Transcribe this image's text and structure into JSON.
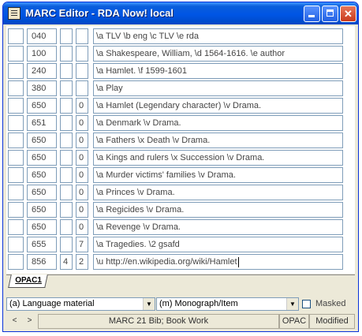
{
  "window": {
    "title": "MARC Editor - RDA Now! local"
  },
  "fields": [
    {
      "tag": "040",
      "ind1": "",
      "ind2": "",
      "data": "\\a TLV \\b eng \\c TLV \\e rda"
    },
    {
      "tag": "100",
      "ind1": "",
      "ind2": "",
      "data": "\\a Shakespeare, William, \\d 1564-1616. \\e author"
    },
    {
      "tag": "240",
      "ind1": "",
      "ind2": "",
      "data": "\\a Hamlet. \\f 1599-1601"
    },
    {
      "tag": "380",
      "ind1": "",
      "ind2": "",
      "data": "\\a Play"
    },
    {
      "tag": "650",
      "ind1": "",
      "ind2": "0",
      "data": "\\a Hamlet (Legendary character) \\v Drama."
    },
    {
      "tag": "651",
      "ind1": "",
      "ind2": "0",
      "data": "\\a Denmark \\v Drama."
    },
    {
      "tag": "650",
      "ind1": "",
      "ind2": "0",
      "data": "\\a Fathers \\x Death \\v Drama."
    },
    {
      "tag": "650",
      "ind1": "",
      "ind2": "0",
      "data": "\\a Kings and rulers \\x Succession \\v Drama."
    },
    {
      "tag": "650",
      "ind1": "",
      "ind2": "0",
      "data": "\\a Murder victims' families \\v Drama."
    },
    {
      "tag": "650",
      "ind1": "",
      "ind2": "0",
      "data": "\\a Princes \\v Drama."
    },
    {
      "tag": "650",
      "ind1": "",
      "ind2": "0",
      "data": "\\a Regicides \\v Drama."
    },
    {
      "tag": "650",
      "ind1": "",
      "ind2": "0",
      "data": "\\a Revenge \\v Drama."
    },
    {
      "tag": "655",
      "ind1": "",
      "ind2": "7",
      "data": "\\a Tragedies. \\2 gsafd"
    },
    {
      "tag": "856",
      "ind1": "4",
      "ind2": "2",
      "data": "\\u http://en.wikipedia.org/wiki/Hamlet"
    }
  ],
  "tabs": [
    {
      "label": "OPAC1"
    }
  ],
  "options": {
    "type_value": "(a) Language material",
    "level_value": "(m) Monograph/Item",
    "masked_label": "Masked",
    "masked_checked": false
  },
  "status": {
    "prev": "<",
    "next": ">",
    "format": "MARC 21 Bib; Book Work",
    "view": "OPAC",
    "state": "Modified"
  },
  "colors": {
    "title_bar": "#0055E5",
    "field_border": "#7F9DB9",
    "window_bg": "#ECE9D8"
  }
}
